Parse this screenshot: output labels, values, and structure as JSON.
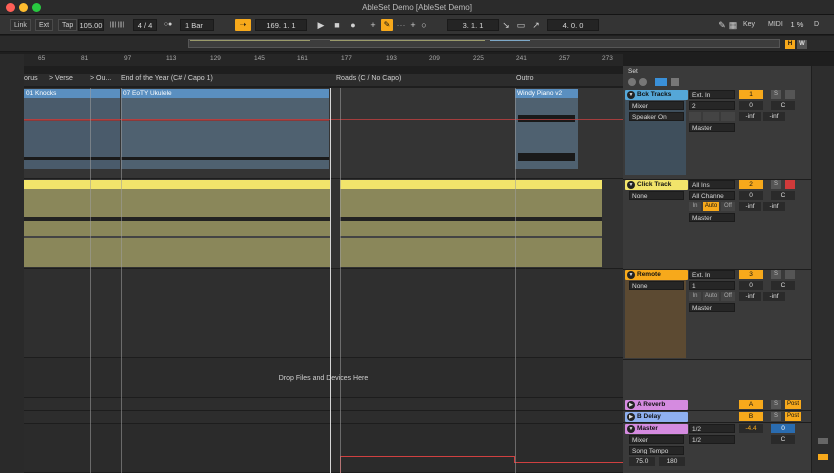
{
  "window": {
    "title": "AbleSet Demo  [AbleSet Demo]"
  },
  "control_bar": {
    "link": "Link",
    "ext": "Ext",
    "tap": "Tap",
    "tempo": "105.00",
    "metronome_glyph": "|||| ||||",
    "time_sig": "4 / 4",
    "quantize_glyph": "○●",
    "quantize": "1 Bar",
    "position": "169.  1.  1",
    "loop_start": "3.  1.  1",
    "loop_length": "4.  0.  0",
    "key": "Key",
    "midi": "MIDI",
    "cpu": "1 %",
    "d": "D"
  },
  "ruler": [
    "65",
    "81",
    "97",
    "113",
    "129",
    "145",
    "161",
    "177",
    "193",
    "209",
    "225",
    "241",
    "257",
    "273"
  ],
  "locators": [
    "orus",
    "> Verse",
    "> Ou...",
    "End of the Year (C# / Capo 1)",
    "Roads (C / No Capo)",
    "Outro"
  ],
  "arrangement": {
    "clips": [
      {
        "name": "01 Knocks"
      },
      {
        "name": "07 EoTY Ukulele"
      },
      {
        "name": "Windy Piano v2"
      }
    ],
    "drop_text": "Drop Files and Devices Here"
  },
  "mixer": {
    "set_label": "Set",
    "tracks": [
      {
        "name": "Bck Tracks",
        "input": "Ext. In",
        "in_ch": "2",
        "routing": "Mixer",
        "out": "Speaker On",
        "output": "Master",
        "num": "1",
        "s": "S",
        "vol": "0",
        "pan": "C",
        "peak_a": "-inf",
        "peak_b": "-inf",
        "color": "#55a7d8"
      },
      {
        "name": "Click Track",
        "input": "All Ins",
        "in_ch": "All Channe",
        "routing": "None",
        "output": "Master",
        "num": "2",
        "s": "S",
        "vol": "0",
        "pan": "C",
        "peak_a": "-inf",
        "peak_b": "-inf",
        "mon_in": "In",
        "mon_auto": "Auto",
        "mon_off": "Off",
        "color": "#f2e46b"
      },
      {
        "name": "Remote",
        "input": "Ext. In",
        "in_ch": "1",
        "routing": "None",
        "output": "Master",
        "num": "3",
        "s": "S",
        "vol": "0",
        "pan": "C",
        "peak_a": "-inf",
        "peak_b": "-inf",
        "mon_in": "In",
        "mon_auto": "Auto",
        "mon_off": "Off",
        "color": "#f7a91b"
      }
    ],
    "returns": [
      {
        "name": "A Reverb",
        "letter": "A",
        "s": "S",
        "post": "Post",
        "color": "#d58be0"
      },
      {
        "name": "B Delay",
        "letter": "B",
        "s": "S",
        "post": "Post",
        "color": "#8fb0f0"
      }
    ],
    "master": {
      "name": "Master",
      "routing": "Mixer",
      "device": "Song Tempo",
      "cue_a": "1/2",
      "cue_b": "1/2",
      "vol": "-4.4",
      "vol2": "0",
      "pan": "C",
      "tempo_min": "75.0",
      "tempo_max": "180",
      "color": "#d58be0"
    }
  },
  "right_rail": {
    "h": "H",
    "w": "W"
  }
}
